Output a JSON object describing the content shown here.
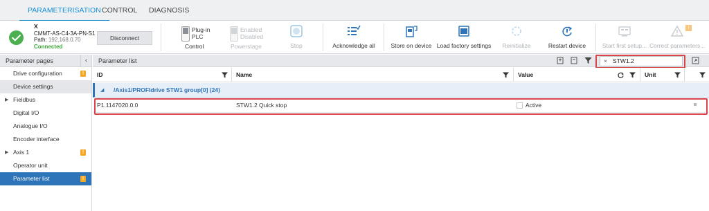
{
  "tabs": [
    {
      "label": "PARAMETERISATION",
      "active": true
    },
    {
      "label": "CONTROL",
      "active": false
    },
    {
      "label": "DIAGNOSIS",
      "active": false
    }
  ],
  "device": {
    "name": "X",
    "model": "CMMT-AS-C4-3A-PN-S1",
    "path_label": "Path:",
    "path_value": "192.168.0.70",
    "status": "Connected",
    "disconnect_label": "Disconnect"
  },
  "toolbar": {
    "control": {
      "opt1": "Plug-in",
      "opt2": "PLC",
      "label": "Control"
    },
    "powerstage": {
      "opt1": "Enabled",
      "opt2": "Disabled",
      "label": "Powerstage"
    },
    "stop_label": "Stop",
    "acknowledge_label": "Acknowledge all",
    "store_label": "Store on device",
    "load_factory_label": "Load factory settings",
    "reinitialize_label": "Reinitialize",
    "restart_label": "Restart device",
    "start_first_setup_label": "Start first setup...",
    "correct_parameters_label": "Correct parameters...",
    "correct_badge": "!"
  },
  "sidebar": {
    "title": "Parameter pages",
    "collapse_glyph": "‹",
    "items": [
      {
        "label": "Drive configuration",
        "warn": "!"
      },
      {
        "label": "Device settings"
      },
      {
        "label": "Fieldbus"
      },
      {
        "label": "Digital I/O"
      },
      {
        "label": "Analogue I/O"
      },
      {
        "label": "Encoder interface"
      },
      {
        "label": "Axis 1",
        "warn": "!"
      },
      {
        "label": "Operator unit"
      },
      {
        "label": "Parameter list",
        "warn": "!"
      }
    ]
  },
  "main": {
    "title": "Parameter list",
    "search": {
      "clear_glyph": "×",
      "value": "STW1.2"
    },
    "columns": {
      "id": "ID",
      "name": "Name",
      "value": "Value",
      "unit": "Unit"
    },
    "group": {
      "label": "/Axis1/PROFIdrive STW1 group[0] (24)"
    },
    "rows": [
      {
        "id": "P1.1147020.0.0",
        "name": "STW1.2 Quick stop",
        "value": "Active"
      }
    ]
  },
  "colors": {
    "accent": "#1a8fd6",
    "selected_nav": "#2d74b8",
    "warning": "#f5a623",
    "connected": "#3aa83a",
    "highlight_box": "#d8444a"
  }
}
